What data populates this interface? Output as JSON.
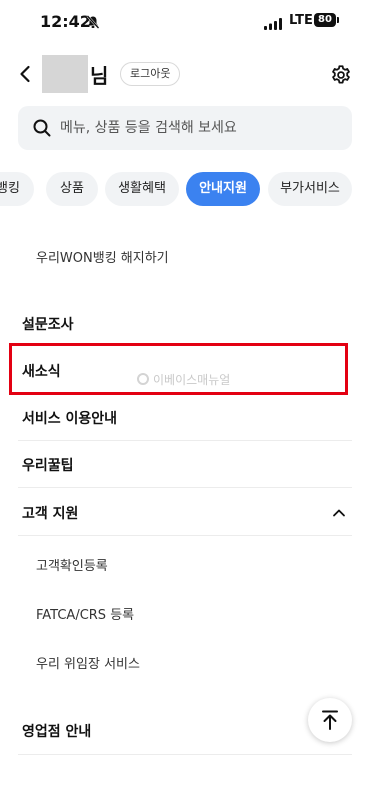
{
  "status_bar": {
    "time": "12:42",
    "network": "LTE",
    "battery": "80"
  },
  "header": {
    "name_suffix": "님",
    "logout_label": "로그아웃"
  },
  "search": {
    "placeholder": "메뉴, 상품 등을 검색해 보세요"
  },
  "tabs": [
    {
      "label": "뱅킹",
      "active": false
    },
    {
      "label": "상품",
      "active": false
    },
    {
      "label": "생활혜택",
      "active": false
    },
    {
      "label": "안내지원",
      "active": true
    },
    {
      "label": "부가서비스",
      "active": false
    }
  ],
  "menu": {
    "cancel_banking": "우리WON뱅킹 해지하기",
    "survey": "설문조사",
    "news": "새소식",
    "service_guide": "서비스 이용안내",
    "tips": "우리꿀팁",
    "customer_support": {
      "label": "고객 지원",
      "items": [
        "고객확인등록",
        "FATCA/CRS 등록",
        "우리 위임장 서비스"
      ]
    },
    "branch_guide": "영업점 안내"
  },
  "watermark": "이베이스매뉴얼",
  "colors": {
    "accent": "#3b82f0",
    "highlight": "#e30012"
  }
}
